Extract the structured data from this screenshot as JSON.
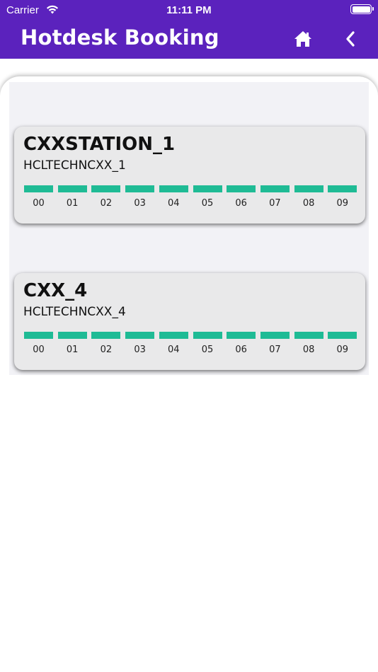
{
  "status_bar": {
    "carrier": "Carrier",
    "time": "11:11 PM"
  },
  "header": {
    "title": "Hotdesk Booking",
    "home_icon": "home-icon",
    "back_icon": "chevron-left-icon",
    "background_color": "#5b22bd"
  },
  "slot_color": "#1fbb95",
  "stations": [
    {
      "name": "CXXSTATION_1",
      "code": "HCLTECHNCXX_1",
      "slots": [
        "00",
        "01",
        "02",
        "03",
        "04",
        "05",
        "06",
        "07",
        "08",
        "09"
      ]
    },
    {
      "name": "CXX_4",
      "code": "HCLTECHNCXX_4",
      "slots": [
        "00",
        "01",
        "02",
        "03",
        "04",
        "05",
        "06",
        "07",
        "08",
        "09"
      ]
    }
  ]
}
